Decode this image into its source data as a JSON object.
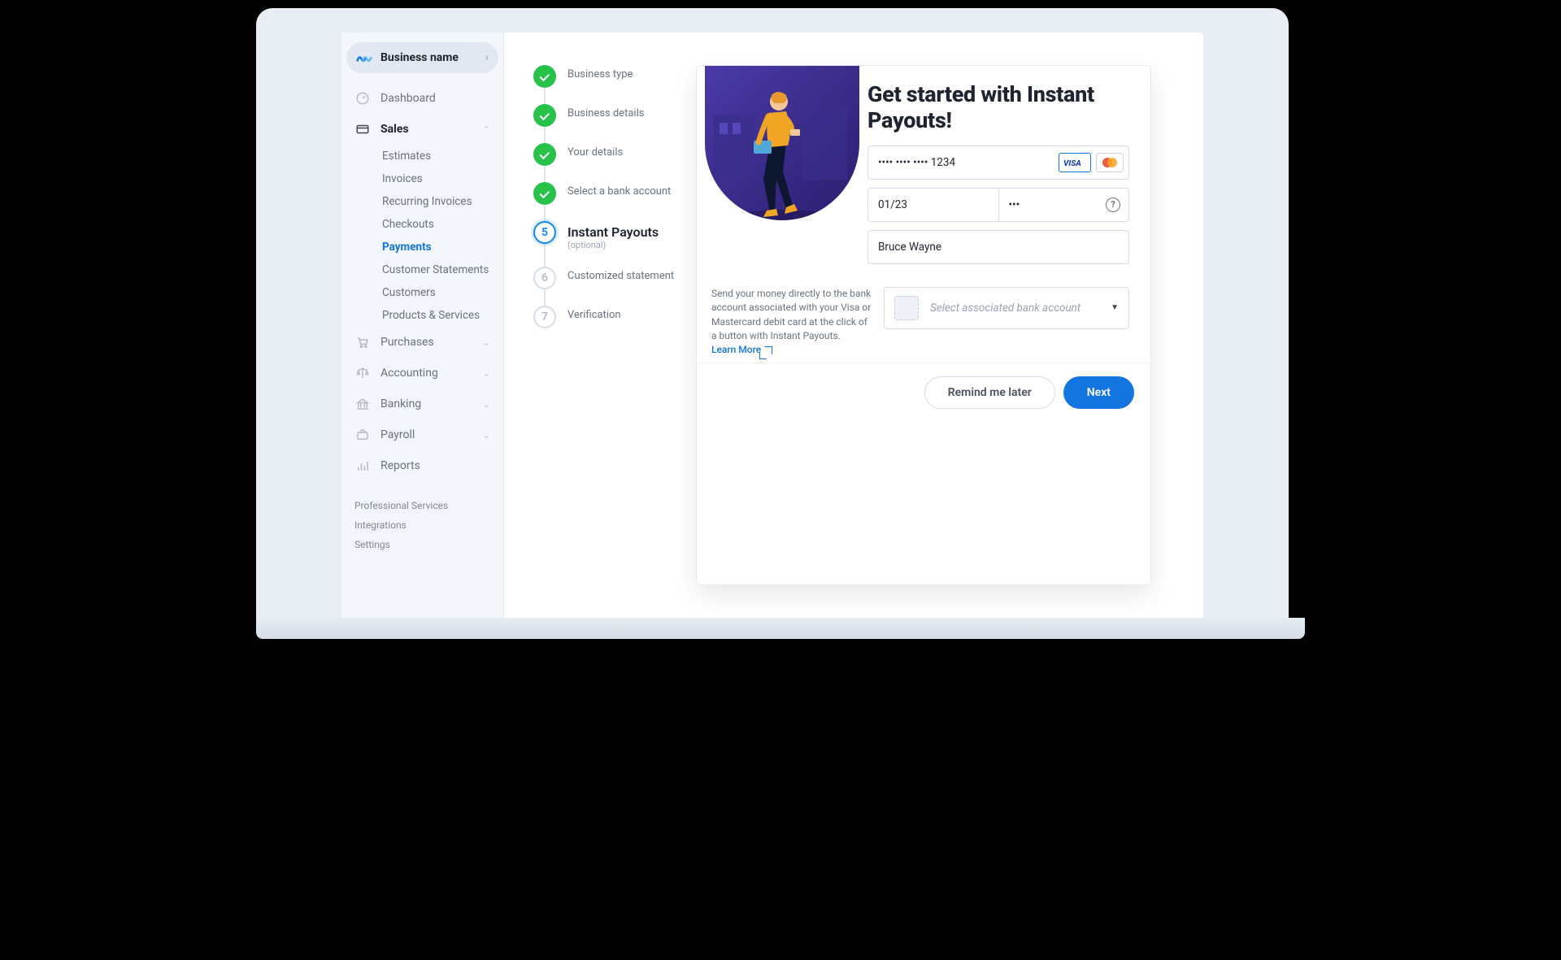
{
  "business": {
    "name": "Business name"
  },
  "sidebar": {
    "dashboard": "Dashboard",
    "sales": "Sales",
    "sales_items": [
      "Estimates",
      "Invoices",
      "Recurring Invoices",
      "Checkouts",
      "Payments",
      "Customer Statements",
      "Customers",
      "Products & Services"
    ],
    "purchases": "Purchases",
    "accounting": "Accounting",
    "banking": "Banking",
    "payroll": "Payroll",
    "reports": "Reports",
    "bottom": [
      "Professional Services",
      "Integrations",
      "Settings"
    ]
  },
  "steps": [
    {
      "title": "Business type",
      "state": "done"
    },
    {
      "title": "Business details",
      "state": "done"
    },
    {
      "title": "Your details",
      "state": "done"
    },
    {
      "title": "Select a bank account",
      "state": "done"
    },
    {
      "title": "Instant Payouts",
      "sub": "(optional)",
      "state": "current",
      "num": "5"
    },
    {
      "title": "Customized statement",
      "state": "future",
      "num": "6"
    },
    {
      "title": "Verification",
      "state": "future",
      "num": "7"
    }
  ],
  "card": {
    "heading": "Get started with Instant Payouts!",
    "card_number": "•••• •••• •••• 1234",
    "expiry": "01/23",
    "cvc": "•••",
    "name": "Bruce Wayne",
    "select_placeholder": "Select associated bank account",
    "desc": "Send your money directly to the bank account associated with your Visa or Mastercard debit card at the click of a button with Instant Payouts.",
    "learn_more": "Learn More",
    "remind": "Remind me later",
    "next": "Next"
  }
}
